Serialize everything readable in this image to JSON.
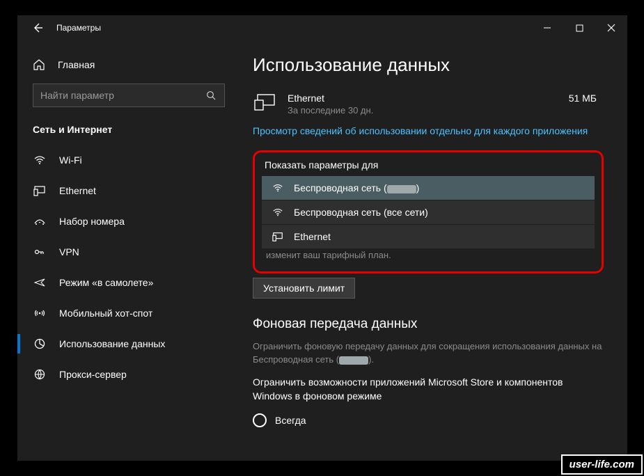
{
  "titlebar": {
    "title": "Параметры"
  },
  "sidebar": {
    "home": "Главная",
    "search_placeholder": "Найти параметр",
    "section": "Сеть и Интернет",
    "items": [
      {
        "label": "Wi-Fi"
      },
      {
        "label": "Ethernet"
      },
      {
        "label": "Набор номера"
      },
      {
        "label": "VPN"
      },
      {
        "label": "Режим «в самолете»"
      },
      {
        "label": "Мобильный хот-спот"
      },
      {
        "label": "Использование данных"
      },
      {
        "label": "Прокси-сервер"
      }
    ]
  },
  "page": {
    "heading": "Использование данных",
    "usage": {
      "name": "Ethernet",
      "period": "За последние 30 дн.",
      "amount": "51 МБ"
    },
    "link": "Просмотр сведений об использовании отдельно для каждого приложения",
    "dropdown": {
      "label": "Показать параметры для",
      "options": [
        "Беспроводная сеть (",
        "Беспроводная сеть (все сети)",
        "Ethernet"
      ],
      "option0_suffix": ")"
    },
    "truncated": "изменит ваш тарифный план.",
    "set_limit": "Установить лимит",
    "bg_heading": "Фоновая передача данных",
    "bg_desc_a": "Ограничить фоновую передачу данных для сокращения использования данных на Беспроводная сеть (",
    "bg_desc_b": ").",
    "bg_desc2": "Ограничить возможности приложений Microsoft Store и компонентов Windows в фоновом режиме",
    "radio_always": "Всегда"
  },
  "watermark": "user-life.com"
}
